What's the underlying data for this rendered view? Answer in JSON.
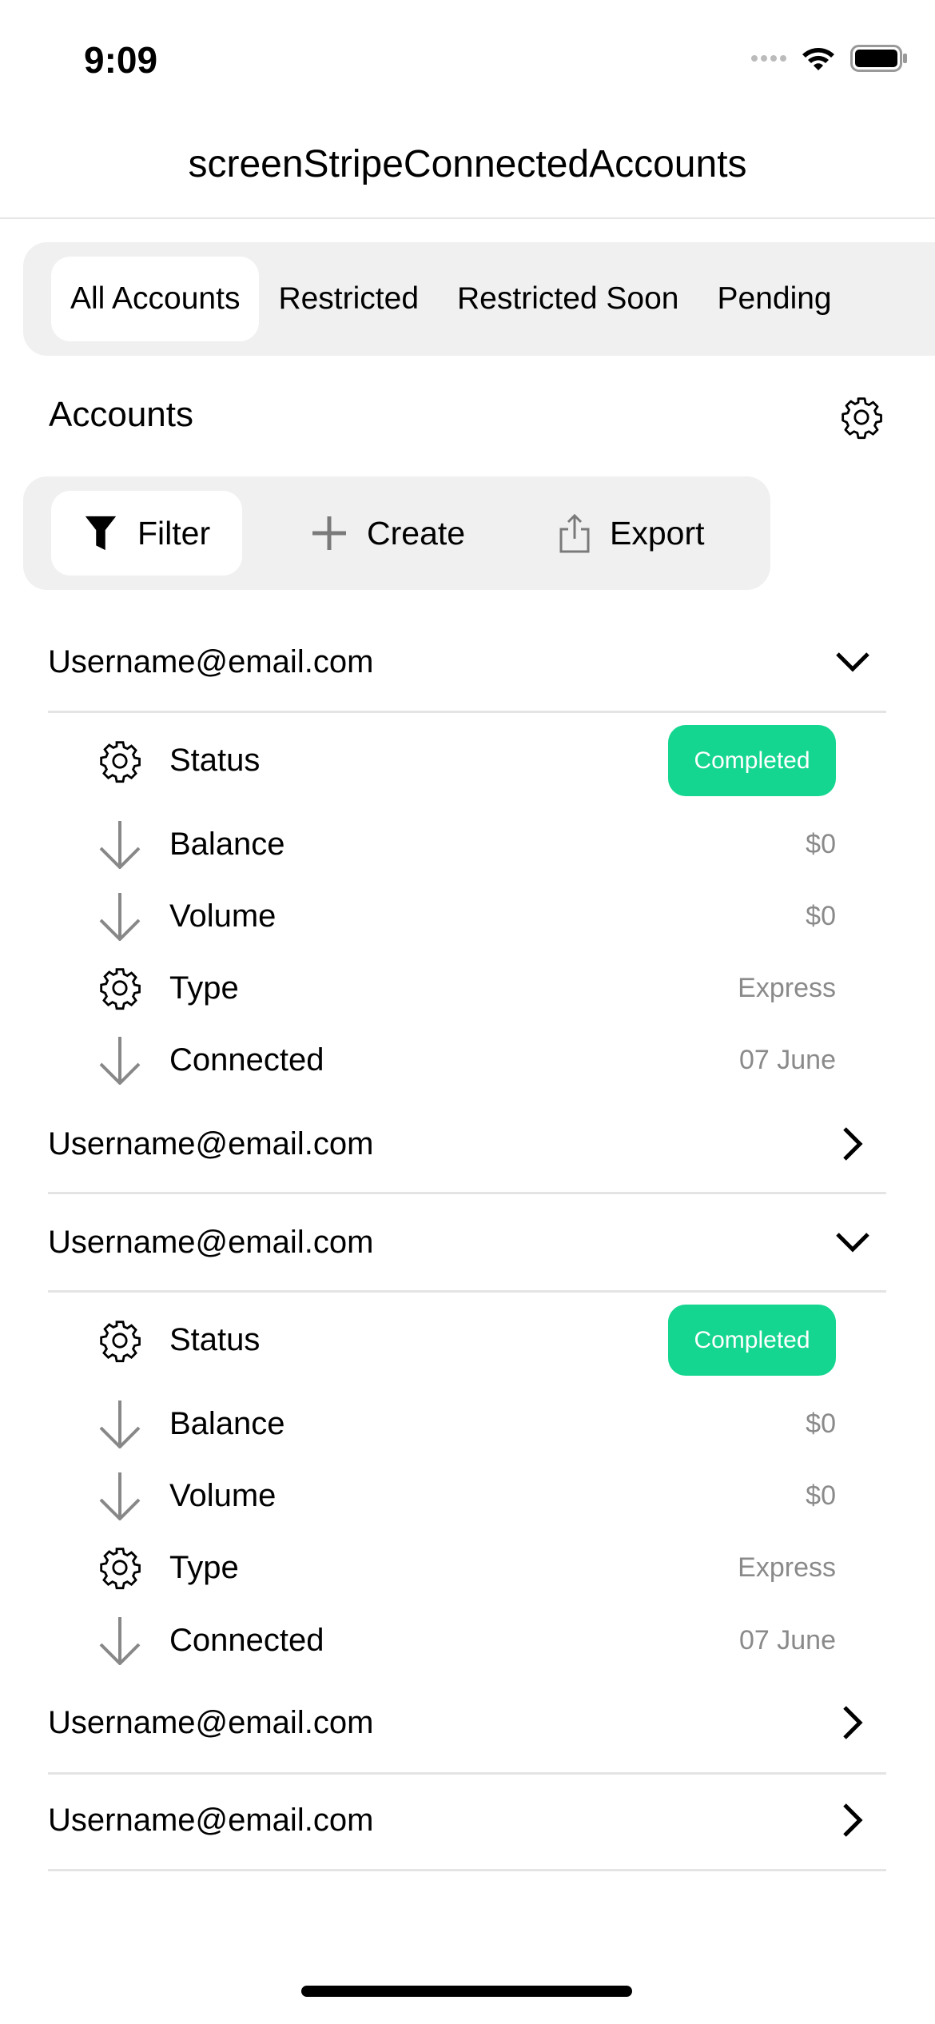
{
  "status_bar": {
    "time": "9:09"
  },
  "header": {
    "title": "screenStripeConnectedAccounts"
  },
  "tabs": [
    {
      "label": "All Accounts"
    },
    {
      "label": "Restricted"
    },
    {
      "label": "Restricted Soon"
    },
    {
      "label": "Pending"
    }
  ],
  "section": {
    "title": "Accounts"
  },
  "toolbar": {
    "filter": "Filter",
    "create": "Create",
    "export": "Export"
  },
  "accounts": [
    {
      "email": "Username@email.com",
      "expanded": true,
      "details": {
        "status_label": "Status",
        "status": "Completed",
        "balance_label": "Balance",
        "balance": "$0",
        "volume_label": "Volume",
        "volume": "$0",
        "type_label": "Type",
        "type": "Express",
        "connected_label": "Connected",
        "connected": "07 June"
      }
    },
    {
      "email": "Username@email.com",
      "expanded": false
    },
    {
      "email": "Username@email.com",
      "expanded": true,
      "details": {
        "status_label": "Status",
        "status": "Completed",
        "balance_label": "Balance",
        "balance": "$0",
        "volume_label": "Volume",
        "volume": "$0",
        "type_label": "Type",
        "type": "Express",
        "connected_label": "Connected",
        "connected": "07 June"
      }
    },
    {
      "email": "Username@email.com",
      "expanded": false
    },
    {
      "email": "Username@email.com",
      "expanded": false
    }
  ],
  "colors": {
    "badge": "#14d690",
    "segment_bg": "#f0f0f0"
  }
}
